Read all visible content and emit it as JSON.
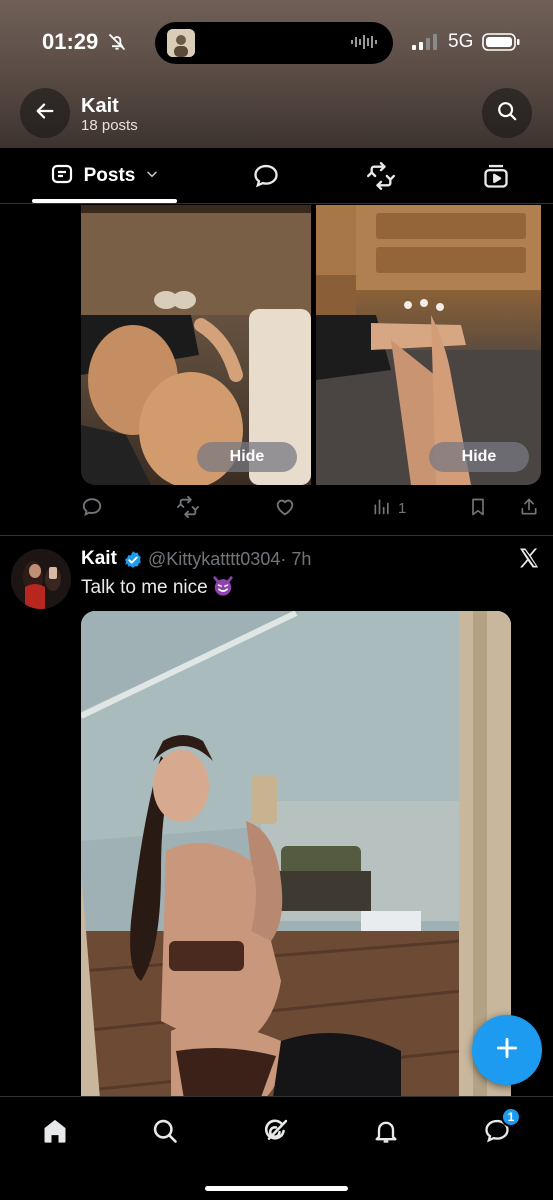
{
  "status_bar": {
    "time": "01:29",
    "network": "5G",
    "icons": [
      "bell-slash-icon",
      "audio-wave-icon",
      "signal-icon",
      "battery-icon"
    ]
  },
  "header": {
    "name": "Kait",
    "post_count": "18 posts",
    "icons": [
      "arrow-left-icon",
      "search-icon"
    ]
  },
  "tabs": {
    "active_label": "Posts",
    "icons": [
      "posts-icon",
      "chevron-down-icon",
      "reply-icon",
      "repost-icon",
      "media-icon"
    ]
  },
  "post1": {
    "hide_left": "Hide",
    "hide_right": "Hide",
    "views": "1",
    "icons": [
      "reply-icon",
      "repost-icon",
      "like-icon",
      "views-icon",
      "bookmark-icon",
      "share-icon"
    ]
  },
  "post2": {
    "author": "Kait",
    "handle": "@Kittykatttt0304",
    "time": "· 7h",
    "text": "Talk to me nice",
    "icons": [
      "verified-icon",
      "x-logo-icon",
      "smiling-devil-emoji"
    ]
  },
  "fab": {
    "icon": "plus-icon"
  },
  "bottom_nav": {
    "icons": [
      "home-icon",
      "search-icon",
      "grok-icon",
      "notifications-icon",
      "messages-icon"
    ],
    "messages_badge": "1"
  },
  "colors": {
    "accent": "#1d9bf0",
    "background": "#000000",
    "muted": "#71767b",
    "divider": "#2f3336"
  }
}
